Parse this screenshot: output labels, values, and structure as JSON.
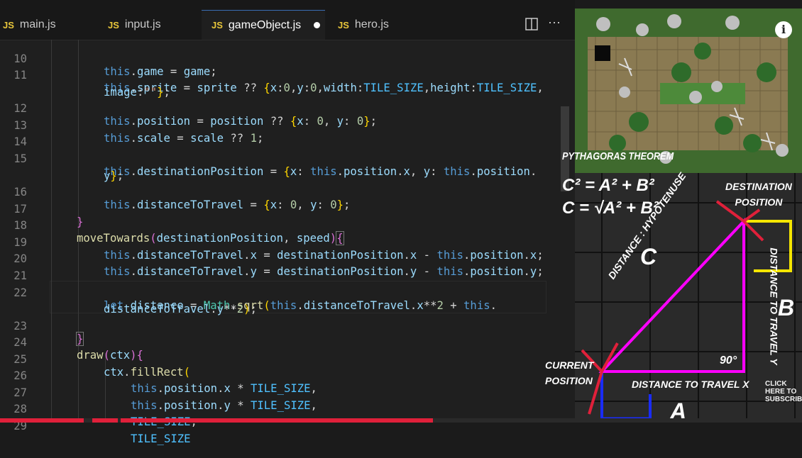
{
  "tabs": [
    {
      "badge": "JS",
      "label": "main.js",
      "active": false,
      "modified": false
    },
    {
      "badge": "JS",
      "label": "input.js",
      "active": false,
      "modified": false
    },
    {
      "badge": "JS",
      "label": "gameObject.js",
      "active": true,
      "modified": true
    },
    {
      "badge": "JS",
      "label": "hero.js",
      "active": false,
      "modified": false
    }
  ],
  "toolbar": {
    "split_icon": "split-editor-icon",
    "more_icon": "more-actions-icon"
  },
  "line_numbers": [
    "10",
    "11",
    "",
    "12",
    "13",
    "14",
    "15",
    "",
    "16",
    "17",
    "18",
    "19",
    "20",
    "21",
    "22",
    "",
    "23",
    "24",
    "25",
    "26",
    "27",
    "28",
    "29"
  ],
  "code_plain": [
    "this.game = game;",
    "this.sprite = sprite ?? {x:0,y:0,width:TILE_SIZE,height:TILE_SIZE,",
    "image:\"\"};",
    "this.position = position ?? {x: 0, y: 0};",
    "this.scale = scale ?? 1;",
    "",
    "this.destinationPosition = {x: this.position.x, y: this.position.",
    "y};",
    "this.distanceToTravel = {x: 0, y: 0};",
    "}",
    "moveTowards(destinationPosition, speed){",
    "this.distanceToTravel.x = destinationPosition.x - this.position.x;",
    "this.distanceToTravel.y = destinationPosition.y - this.position.y;",
    "",
    "let distance = Math.sqrt(this.distanceToTravel.x**2 + this.",
    "distanceToTravel.y**2);",
    "}",
    "draw(ctx){",
    "ctx.fillRect(",
    "this.position.x * TILE_SIZE,",
    "this.position.y * TILE_SIZE,",
    "TILE_SIZE,",
    "TILE_SIZE"
  ],
  "diagram": {
    "title": "PYTHAGORAS THEOREM",
    "formula1": "C² = A² + B²",
    "formula2": "C = √A² + B²",
    "destination": "DESTINATION\nPOSITION",
    "current": "CURRENT\nPOSITION",
    "label_c": "C",
    "label_b": "B",
    "label_a": "A",
    "hyp": "DISTANCE : HYPOTENUSE",
    "dist_y": "DISTANCE TO TRAVEL Y",
    "dist_x": "DISTANCE TO TRAVEL X",
    "angle": "90°",
    "subscribe": "CLICK\nHERE TO\nSUBSCRIBE"
  },
  "info_icon": "info-icon",
  "colors": {
    "triangle": "#ff00ff",
    "accent_red": "#e0203a",
    "yellow": "#f5e600",
    "blue": "#1a2cff"
  }
}
